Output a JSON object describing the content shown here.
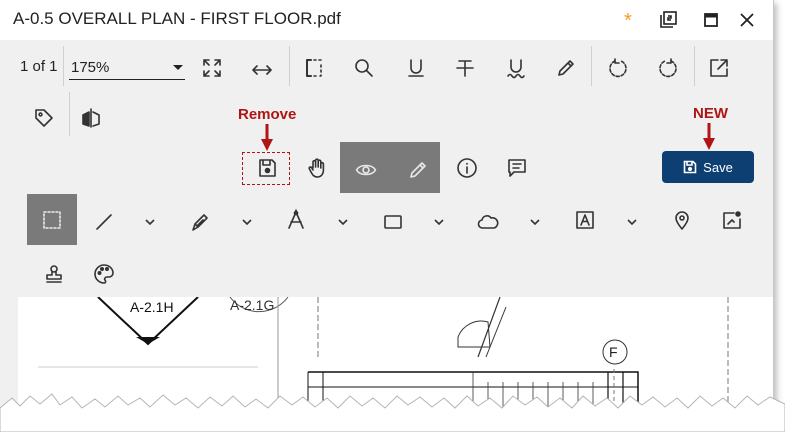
{
  "window": {
    "title": "A-0.5 OVERALL PLAN - FIRST FLOOR.pdf",
    "unsaved_marker": "*"
  },
  "toolbar": {
    "page_count": "1 of 1",
    "zoom_value": "175%"
  },
  "annotations": {
    "remove_label": "Remove",
    "new_label": "NEW"
  },
  "save_button": {
    "label": "Save"
  },
  "drawing": {
    "tag_1": "A-2.1H",
    "tag_2": "A-2.1G",
    "grid_label": "F"
  },
  "colors": {
    "accent": "#0d3f73",
    "annotation": "#b01515",
    "asterisk": "#f59b23",
    "active_tool": "#7a7a7a"
  }
}
